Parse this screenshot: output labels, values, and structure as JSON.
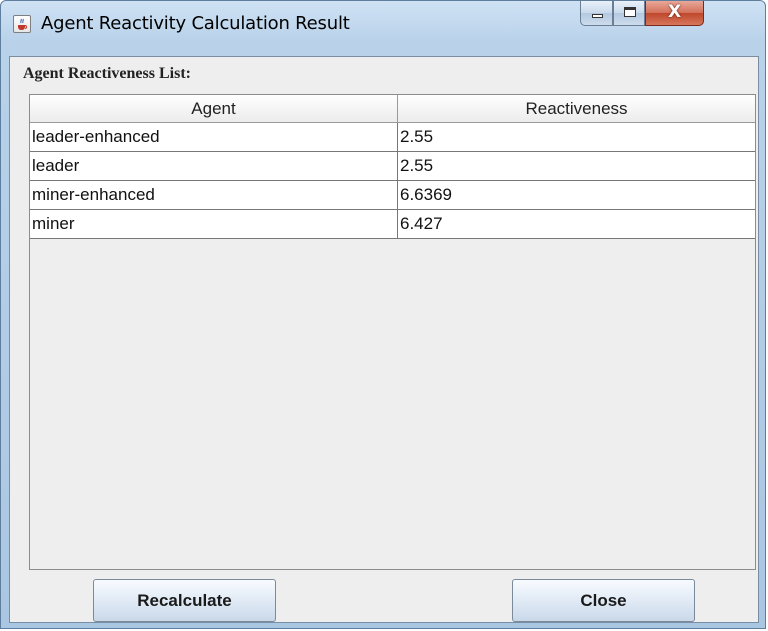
{
  "window": {
    "title": "Agent Reactivity Calculation Result",
    "icon": "java-cup-icon",
    "controls": {
      "minimize": "minimize",
      "maximize": "maximize",
      "close": "X"
    }
  },
  "list": {
    "heading": "Agent Reactiveness List:",
    "columns": [
      "Agent",
      "Reactiveness"
    ],
    "rows": [
      [
        "leader-enhanced",
        "2.55"
      ],
      [
        "leader",
        "2.55"
      ],
      [
        "miner-enhanced",
        "6.6369"
      ],
      [
        "miner",
        "6.427"
      ]
    ]
  },
  "buttons": {
    "recalculate": "Recalculate",
    "close": "Close"
  },
  "colors": {
    "close_button": "#c0472c",
    "frame": "#b9d2ea"
  }
}
